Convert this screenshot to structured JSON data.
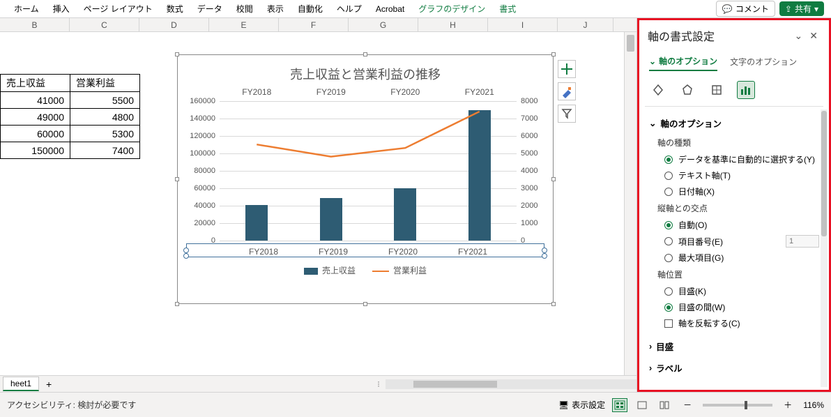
{
  "ribbon": {
    "tabs": [
      "ホーム",
      "挿入",
      "ページ レイアウト",
      "数式",
      "データ",
      "校閲",
      "表示",
      "自動化",
      "ヘルプ",
      "Acrobat",
      "グラフのデザイン",
      "書式"
    ],
    "comment": "コメント",
    "share": "共有"
  },
  "columns": [
    "B",
    "C",
    "D",
    "E",
    "F",
    "G",
    "H",
    "I",
    "J"
  ],
  "table": {
    "headers": [
      "売上収益",
      "営業利益"
    ],
    "rows": [
      [
        41000,
        5500
      ],
      [
        49000,
        4800
      ],
      [
        60000,
        5300
      ],
      [
        150000,
        7400
      ]
    ]
  },
  "chart_data": {
    "type": "bar",
    "title": "売上収益と営業利益の推移",
    "categories": [
      "FY2018",
      "FY2019",
      "FY2020",
      "FY2021"
    ],
    "series": [
      {
        "name": "売上収益",
        "type": "bar",
        "values": [
          41000,
          49000,
          60000,
          150000
        ],
        "axis": "left"
      },
      {
        "name": "営業利益",
        "type": "line",
        "values": [
          5500,
          4800,
          5300,
          7400
        ],
        "axis": "right"
      }
    ],
    "left_axis": {
      "ticks": [
        0,
        20000,
        40000,
        60000,
        80000,
        100000,
        120000,
        140000,
        160000
      ],
      "max": 160000
    },
    "right_axis": {
      "ticks": [
        0,
        1000,
        2000,
        3000,
        4000,
        5000,
        6000,
        7000,
        8000
      ],
      "max": 8000
    }
  },
  "sheet_tab": "heet1",
  "pane": {
    "title": "軸の書式設定",
    "tab_active": "軸のオプション",
    "tab_inactive": "文字のオプション",
    "section": "軸のオプション",
    "axis_type_label": "軸の種類",
    "axis_type_opts": [
      "データを基準に自動的に選択する(Y)",
      "テキスト軸(T)",
      "日付軸(X)"
    ],
    "cross_label": "縦軸との交点",
    "cross_opts": [
      "自動(O)",
      "項目番号(E)",
      "最大項目(G)"
    ],
    "cross_input_placeholder": "1",
    "pos_label": "軸位置",
    "pos_opts": [
      "目盛(K)",
      "目盛の間(W)"
    ],
    "reverse": "軸を反転する(C)",
    "coll1": "目盛",
    "coll2": "ラベル"
  },
  "status": {
    "accessibility": "アクセシビリティ: 検討が必要です",
    "display": "表示設定",
    "zoom": "116%"
  }
}
